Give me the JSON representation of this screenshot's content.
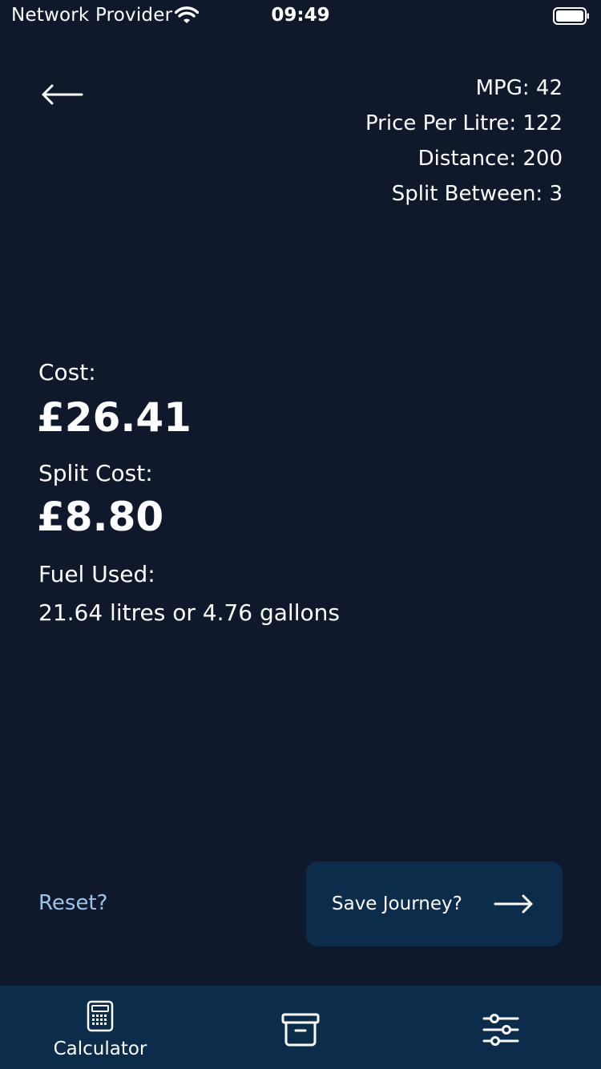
{
  "status_bar": {
    "carrier": "Network Provider",
    "time": "09:49"
  },
  "summary": {
    "mpg": "MPG: 42",
    "price_per_litre": "Price Per Litre: 122",
    "distance": "Distance: 200",
    "split_between": "Split Between: 3"
  },
  "results": {
    "cost_label": "Cost:",
    "cost_value": "£26.41",
    "split_cost_label": "Split Cost:",
    "split_cost_value": "£8.80",
    "fuel_used_label": "Fuel Used:",
    "fuel_used_value": "21.64 litres or 4.76 gallons"
  },
  "actions": {
    "reset_label": "Reset?",
    "save_label": "Save Journey?"
  },
  "tab_bar": {
    "tabs": [
      {
        "label": "Calculator",
        "icon": "calculator-icon",
        "active": true
      },
      {
        "label": "",
        "icon": "archive-icon",
        "active": false
      },
      {
        "label": "",
        "icon": "sliders-icon",
        "active": false
      }
    ]
  },
  "colors": {
    "background": "#0f192b",
    "tab_bar": "#0b2c4a",
    "save_button": "#0b2c4a",
    "link": "#9cc3ea",
    "text": "#ffffff"
  }
}
